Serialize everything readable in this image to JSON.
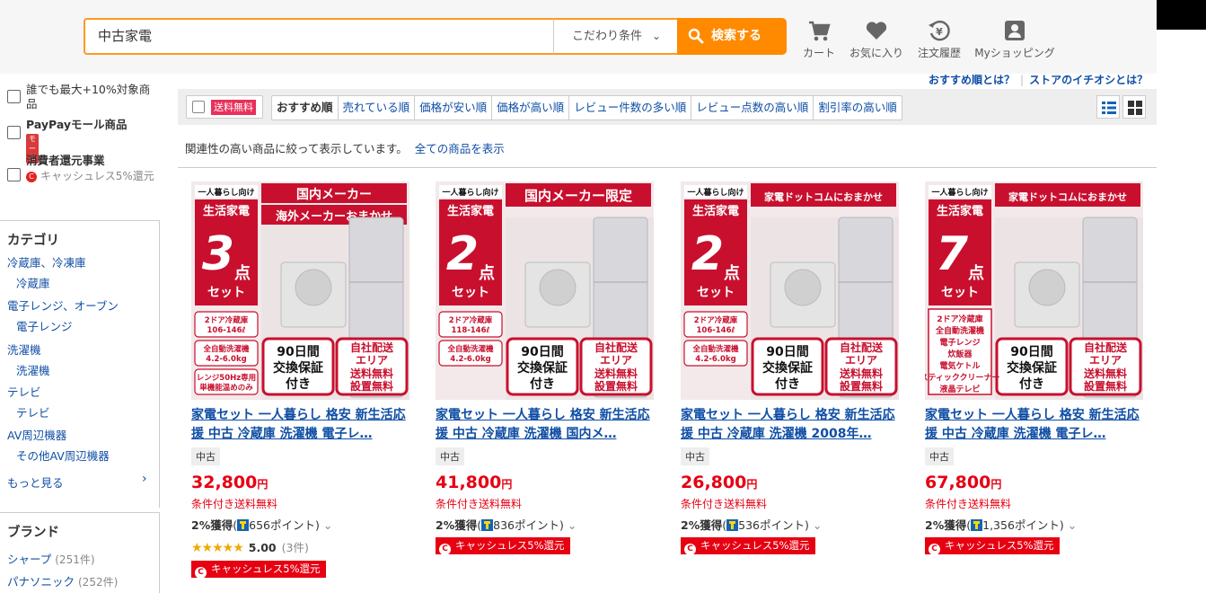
{
  "header": {
    "search_value": "中古家電",
    "condition_label": "こだわり条件",
    "search_button": "検索する",
    "nav": [
      {
        "label": "カート",
        "icon": "cart-icon"
      },
      {
        "label": "お気に入り",
        "icon": "heart-icon"
      },
      {
        "label": "注文履歴",
        "icon": "order-history-icon"
      },
      {
        "label": "Myショッピング",
        "icon": "user-icon"
      }
    ]
  },
  "help_links": [
    "おすすめ順とは？",
    "ストアのイチオシとは？"
  ],
  "sidebar": {
    "filters": [
      {
        "label": "誰でも最大+10%対象商品"
      },
      {
        "label": "PayPayモール商品",
        "badge": "モール"
      },
      {
        "label": "消費者還元事業",
        "sub": "キャッシュレス5%還元"
      }
    ],
    "category_title": "カテゴリ",
    "categories": [
      {
        "label": "冷蔵庫、冷凍庫",
        "sub": "冷蔵庫"
      },
      {
        "label": "電子レンジ、オーブン",
        "sub": "電子レンジ"
      },
      {
        "label": "洗濯機",
        "sub": "洗濯機"
      },
      {
        "label": "テレビ",
        "sub": "テレビ"
      },
      {
        "label": "AV周辺機器",
        "sub": "その他AV周辺機器"
      }
    ],
    "more_label": "もっと見る",
    "brand_title": "ブランド",
    "brands": [
      {
        "label": "シャープ",
        "count": "(251件)"
      },
      {
        "label": "パナソニック",
        "count": "(252件)"
      }
    ]
  },
  "sortbar": {
    "free_shipping": "送料無料",
    "tabs": [
      "おすすめ順",
      "売れている順",
      "価格が安い順",
      "価格が高い順",
      "レビュー件数の多い順",
      "レビュー点数の高い順",
      "割引率の高い順"
    ]
  },
  "relevance_note": "関連性の高い商品に絞って表示しています。",
  "show_all_link": "全ての商品を表示",
  "products": [
    {
      "title": "家電セット 一人暮らし 格安 新生活応援 中古 冷蔵庫 洗濯機 電子レ…",
      "condition": "中古",
      "price": "32,800",
      "yen": "円",
      "shipping": "条件付き送料無料",
      "points_rate": "2%獲得",
      "points": "656ポイント",
      "has_rating": true,
      "stars": "★★★★★",
      "score": "5.00",
      "reviews": "(3件)",
      "cashless": "キャッシュレス5%還元",
      "img": {
        "top": "一人暮らし向け",
        "title": "生活家電",
        "num": "3",
        "pt": "点",
        "set": "セット",
        "banner1": "国内メーカー",
        "banner2": "海外メーカーおまかせ",
        "spec1": "2ドア冷蔵庫 106-146ℓ",
        "spec2": "全自動洗濯機 4.2-6.0kg",
        "spec3": "レンジ50Hz専用 単機能温めのみ",
        "g1": "90日間",
        "g2": "交換保証",
        "g3": "付き",
        "d1": "自社配送",
        "d2": "エリア",
        "d3": "送料無料",
        "d4": "設置無料"
      }
    },
    {
      "title": "家電セット 一人暮らし 格安 新生活応援 中古 冷蔵庫 洗濯機 国内メ…",
      "condition": "中古",
      "price": "41,800",
      "yen": "円",
      "shipping": "条件付き送料無料",
      "points_rate": "2%獲得",
      "points": "836ポイント",
      "has_rating": false,
      "cashless": "キャッシュレス5%還元",
      "img": {
        "top": "一人暮らし向け",
        "title": "生活家電",
        "num": "2",
        "pt": "点",
        "set": "セット",
        "banner1": "国内メーカー限定",
        "banner2": "",
        "spec1": "2ドア冷蔵庫 118-146ℓ",
        "spec2": "全自動洗濯機 4.2-6.0kg",
        "spec3": "",
        "g1": "90日間",
        "g2": "交換保証",
        "g3": "付き",
        "d1": "自社配送",
        "d2": "エリア",
        "d3": "送料無料",
        "d4": "設置無料"
      }
    },
    {
      "title": "家電セット 一人暮らし 格安 新生活応援 中古 冷蔵庫 洗濯機 2008年…",
      "condition": "中古",
      "price": "26,800",
      "yen": "円",
      "shipping": "条件付き送料無料",
      "points_rate": "2%獲得",
      "points": "536ポイント",
      "has_rating": false,
      "cashless": "キャッシュレス5%還元",
      "img": {
        "top": "一人暮らし向け",
        "title": "生活家電",
        "num": "2",
        "pt": "点",
        "set": "セット",
        "banner1": "家電ドットコムにおまかせ",
        "banner2": "",
        "spec1": "2ドア冷蔵庫 106-146ℓ",
        "spec2": "全自動洗濯機 4.2-6.0kg",
        "spec3": "",
        "g1": "90日間",
        "g2": "交換保証",
        "g3": "付き",
        "d1": "自社配送",
        "d2": "エリア",
        "d3": "送料無料",
        "d4": "設置無料"
      }
    },
    {
      "title": "家電セット 一人暮らし 格安 新生活応援 中古 冷蔵庫 洗濯機 電子レ…",
      "condition": "中古",
      "price": "67,800",
      "yen": "円",
      "shipping": "条件付き送料無料",
      "points_rate": "2%獲得",
      "points": "1,356ポイント",
      "has_rating": false,
      "cashless": "キャッシュレス5%還元",
      "img": {
        "top": "一人暮らし向け",
        "title": "生活家電",
        "num": "7",
        "pt": "点",
        "set": "セット",
        "banner1": "家電ドットコムにおまかせ",
        "banner2": "",
        "spec1": "2ドア冷蔵庫 全自動洗濯機 電子レンジ 炊飯器 電気ケトル スティッククリーナー 液晶テレビ",
        "spec2": "",
        "spec3": "",
        "g1": "90日間",
        "g2": "交換保証",
        "g3": "付き",
        "d1": "自社配送",
        "d2": "エリア",
        "d3": "送料無料",
        "d4": "設置無料"
      }
    }
  ],
  "colors": {
    "accent": "#ff8a00",
    "link": "#0f4ea5",
    "price": "#e60012",
    "banner_red": "#c8102e"
  }
}
